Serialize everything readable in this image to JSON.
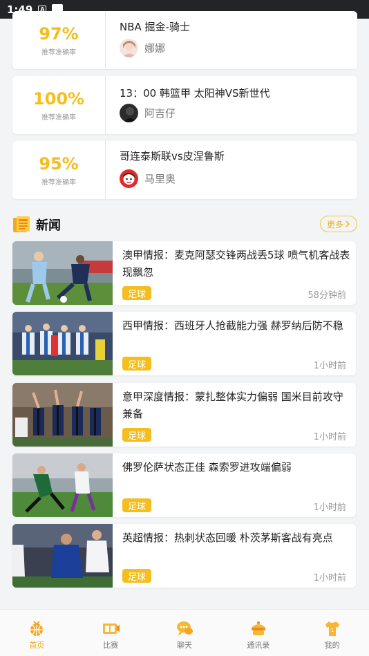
{
  "status_bar": {
    "time": "1:49",
    "icon_a": "A"
  },
  "tips": [
    {
      "rate": "97%",
      "rate_label": "推荐准确率",
      "title": "NBA 掘金-骑士",
      "author": "娜娜"
    },
    {
      "rate": "100%",
      "rate_label": "推荐准确率",
      "title": "13：00 韩篮甲 太阳神VS新世代",
      "author": "阿吉仔"
    },
    {
      "rate": "95%",
      "rate_label": "推荐准确率",
      "title": "哥连泰斯联vs皮涅鲁斯",
      "author": "马里奥"
    }
  ],
  "news_section": {
    "title": "新闻",
    "more": "更多"
  },
  "news": [
    {
      "headline": "澳甲情报：麦克阿瑟交锋两战丢5球 喷气机客战表现飘忽",
      "tag": "足球",
      "time": "58分钟前"
    },
    {
      "headline": "西甲情报：西班牙人抢截能力强 赫罗纳后防不稳",
      "tag": "足球",
      "time": "1小时前"
    },
    {
      "headline": "意甲深度情报：蒙扎整体实力偏弱 国米目前攻守兼备",
      "tag": "足球",
      "time": "1小时前"
    },
    {
      "headline": "佛罗伦萨状态正佳 森索罗进攻端偏弱",
      "tag": "足球",
      "time": "1小时前"
    },
    {
      "headline": "英超情报：热刺状态回暖 朴茨茅斯客战有亮点",
      "tag": "足球",
      "time": "1小时前"
    }
  ],
  "tabbar": {
    "active": "首页",
    "items": [
      {
        "label": "首页",
        "icon": "home-basketball-icon"
      },
      {
        "label": "比赛",
        "icon": "scoreboard-icon"
      },
      {
        "label": "聊天",
        "icon": "chat-bubble-icon"
      },
      {
        "label": "通讯录",
        "icon": "contacts-icon"
      },
      {
        "label": "我的",
        "icon": "jersey-icon"
      }
    ]
  },
  "colors": {
    "accent": "#f5be1e",
    "tab_active": "#f0a818"
  }
}
